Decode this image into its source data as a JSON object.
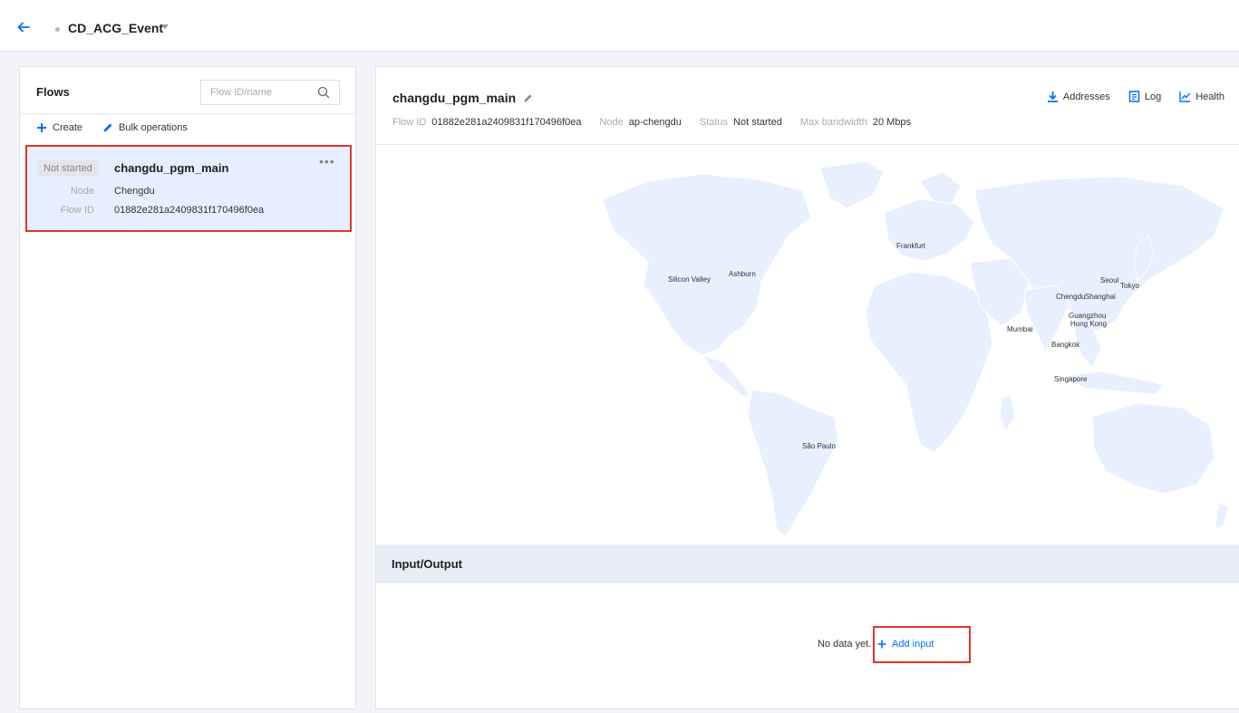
{
  "header": {
    "event_name": "CD_ACG_Event"
  },
  "left": {
    "title": "Flows",
    "search_placeholder": "Flow ID/name",
    "create_label": "Create",
    "bulk_label": "Bulk operations",
    "flow": {
      "status": "Not started",
      "name": "changdu_pgm_main",
      "more": "•••",
      "node_label": "Node",
      "node_value": "Chengdu",
      "id_label": "Flow ID",
      "id_value": "01882e281a2409831f170496f0ea"
    }
  },
  "detail": {
    "title": "changdu_pgm_main",
    "actions": {
      "addresses": "Addresses",
      "log": "Log",
      "health": "Health"
    },
    "meta": {
      "flow_id_label": "Flow ID",
      "flow_id_value": "01882e281a2409831f170496f0ea",
      "node_label": "Node",
      "node_value": "ap-chengdu",
      "status_label": "Status",
      "status_value": "Not started",
      "bandwidth_label": "Max bandwidth",
      "bandwidth_value": "20 Mbps"
    },
    "map_cities": {
      "frankfurt": "Frankfurt",
      "silicon_valley": "Silicon Valley",
      "ashburn": "Ashburn",
      "seoul": "Seoul",
      "tokyo": "Tokyo",
      "chengdu": "Chengdu",
      "shanghai": "Shanghai",
      "guangzhou": "Guangzhou",
      "hong_kong": "Hong Kong",
      "mumbai": "Mumbai",
      "bangkok": "Bangkok",
      "singapore": "Singapore",
      "sao_paulo": "São Paulo"
    },
    "io": {
      "title": "Input/Output",
      "empty": "No data yet.",
      "add_input": "Add input"
    }
  },
  "colors": {
    "accent": "#006eff",
    "highlight_border": "#e0352b",
    "map_land": "#e8efff",
    "selected_bg": "#e6efff"
  }
}
